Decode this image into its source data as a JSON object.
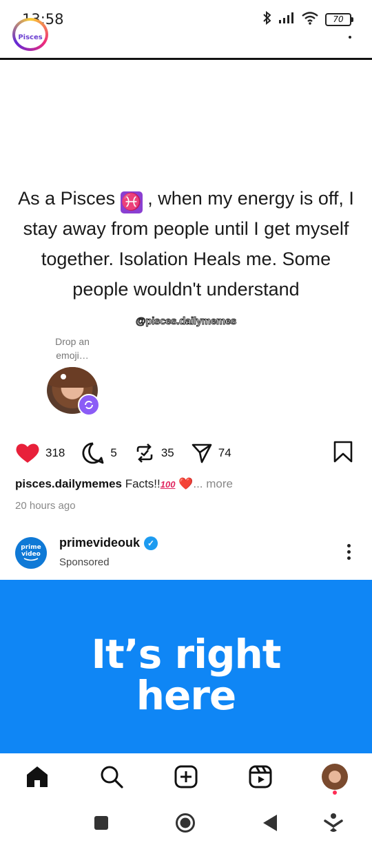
{
  "status_bar": {
    "time": "13:58",
    "battery": "70"
  },
  "prev_post": {
    "avatar_label": "Pisces"
  },
  "post": {
    "text_before_symbol": "As a Pisces",
    "zodiac_symbol": "♓",
    "text_after_symbol": ", when my energy is off, I stay away from people until I get myself together. Isolation Heals me. Some people wouldn't understand",
    "watermark": "@pisces.dailymemes",
    "emoji_prompt": "Drop an emoji…"
  },
  "actions": {
    "likes": "318",
    "comments": "5",
    "reposts": "35",
    "shares": "74"
  },
  "caption": {
    "username": "pisces.dailymemes",
    "text": "Facts!!",
    "hundred": "100",
    "heart": "❤️",
    "more": "... more"
  },
  "time_ago": "20 hours ago",
  "sponsored": {
    "avatar_line1": "prime",
    "avatar_line2": "video",
    "username": "primevideouk",
    "label": "Sponsored",
    "ad_line1": "It’s right",
    "ad_line2": "here",
    "brand_color": "#0f86f5"
  },
  "colors": {
    "like": "#e8203a",
    "verified": "#1d9bf0"
  }
}
